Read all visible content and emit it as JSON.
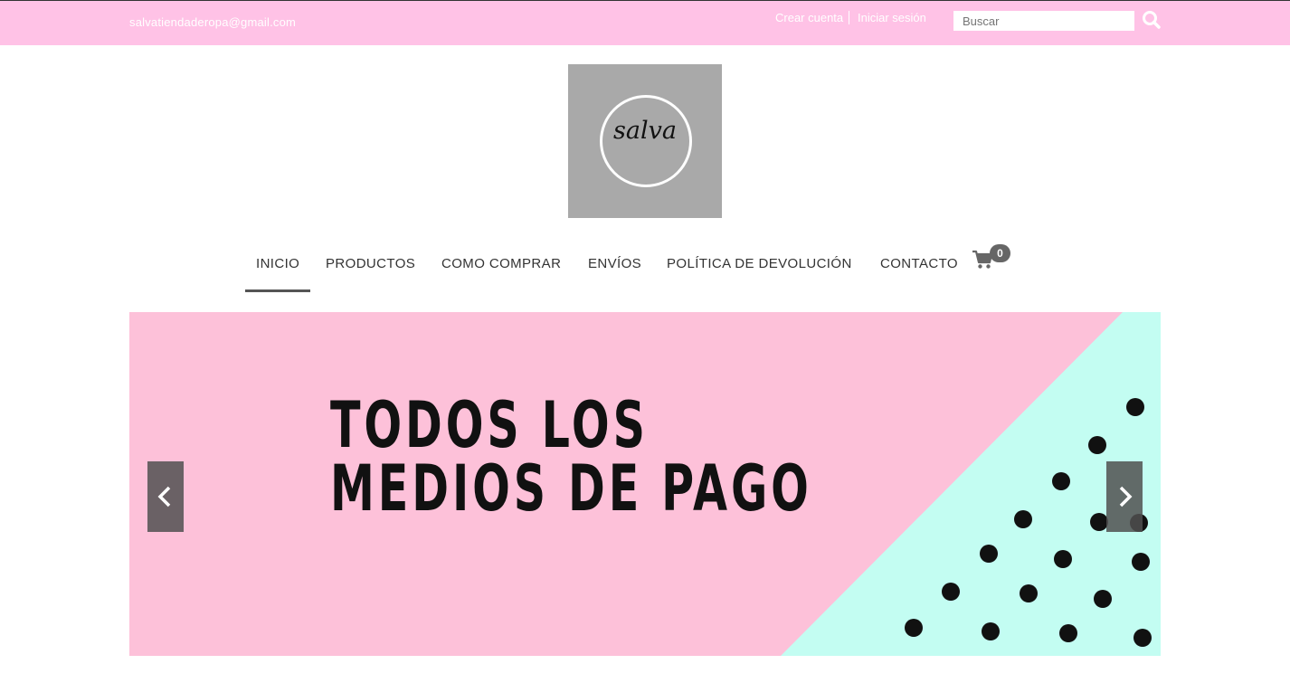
{
  "topbar": {
    "email": "salvatiendaderopa@gmail.com",
    "create_account": "Crear cuenta",
    "login": "Iniciar sesión",
    "search_placeholder": "Buscar"
  },
  "logo": {
    "text": "salva"
  },
  "nav": {
    "items": [
      {
        "label": "INICIO",
        "active": true
      },
      {
        "label": "PRODUCTOS"
      },
      {
        "label": "COMO COMPRAR"
      },
      {
        "label": "ENVÍOS"
      },
      {
        "label": "POLÍTICA DE DEVOLUCIÓN"
      },
      {
        "label": "CONTACTO"
      }
    ],
    "cart_count": "0"
  },
  "hero": {
    "line1": "TODOS LOS",
    "line2": "MEDIOS DE PAGO"
  },
  "colors": {
    "topbar": "#ffc2e6",
    "hero_pink": "#fdc1d9",
    "hero_mint": "#c3fdf2",
    "logo_bg": "#a9a9a9"
  },
  "icons": [
    "search-icon",
    "cart-icon",
    "chevron-left-icon",
    "chevron-right-icon"
  ]
}
